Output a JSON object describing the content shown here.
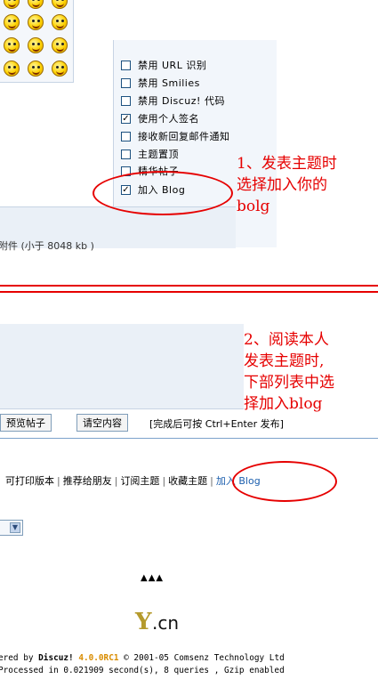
{
  "options": [
    {
      "label": "禁用 URL 识别",
      "checked": false
    },
    {
      "label": "禁用 Smilies",
      "checked": false
    },
    {
      "label": "禁用 Discuz! 代码",
      "checked": false
    },
    {
      "label": "使用个人签名",
      "checked": true
    },
    {
      "label": "接收新回复邮件通知",
      "checked": false
    },
    {
      "label": "主题置顶",
      "checked": false
    },
    {
      "label": "精华帖子",
      "checked": false
    },
    {
      "label": "加入 Blog",
      "checked": true
    }
  ],
  "attachment_text": "附件 (小于 8048 kb )",
  "annotation_1": {
    "line1": "1、发表主题时",
    "line2": "选择加入你的",
    "line3": "bolg"
  },
  "annotation_2": {
    "line1": "2、阅读本人",
    "line2": "发表主题时,",
    "line3": "下部列表中选",
    "line4": "择加入blog"
  },
  "buttons": {
    "preview": "预览帖子",
    "clear": "请空内容"
  },
  "shortcut_hint": "[完成后可按 Ctrl+Enter 发布]",
  "thread_links": [
    "可打印版本",
    "推荐给朋友",
    "订阅主题",
    "收藏主题"
  ],
  "blog_link": "加入 Blog",
  "link_separator": "|",
  "select_arrow": "▼",
  "up_arrows": "▲▲▲",
  "logo": {
    "mark": "Y",
    "tld": ".cn"
  },
  "footer": {
    "powered_prefix": "ered by ",
    "brand": "Discuz!",
    "version": "4.0.0RC1",
    "copyright": " © 2001-05 Comsenz Technology Ltd",
    "stats": "Processed in 0.021909 second(s), 8 queries , Gzip enabled"
  },
  "colors": {
    "annotation": "#e60000",
    "link_blue": "#1c5fae",
    "panel_bg": "#eaf0f7",
    "border": "#7f9db9"
  },
  "icons": [
    "smiley-icon",
    "checkbox-icon",
    "dropdown-arrow-icon"
  ]
}
